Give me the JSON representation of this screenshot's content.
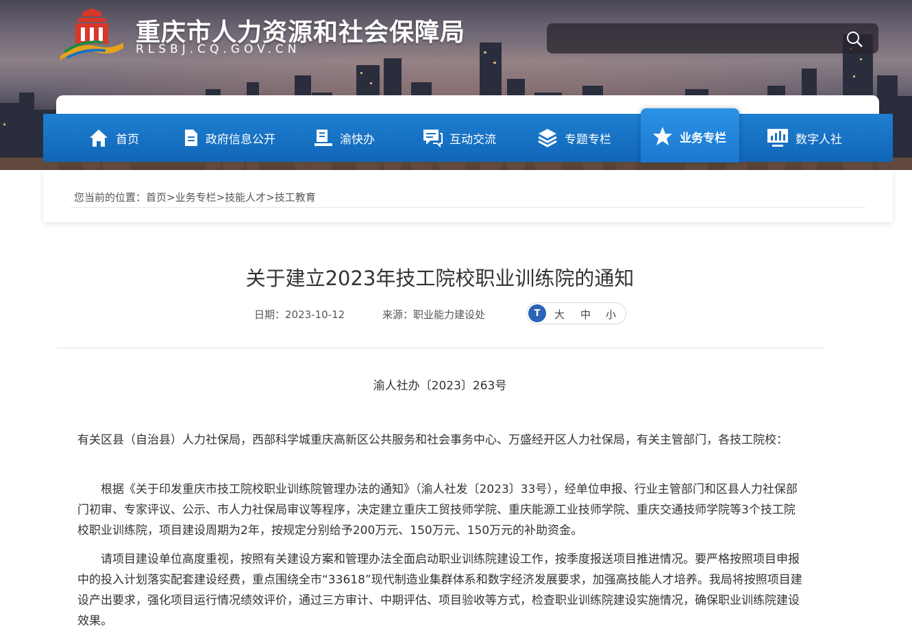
{
  "header": {
    "site_title": "重庆市人力资源和社会保障局",
    "site_domain": "RLSBJ.CQ.GOV.CN",
    "search_icon": "search-icon"
  },
  "nav": {
    "items": [
      {
        "label": "首页",
        "icon": "home-icon"
      },
      {
        "label": "政府信息公开",
        "icon": "document-icon"
      },
      {
        "label": "渝快办",
        "icon": "desk-icon"
      },
      {
        "label": "互动交流",
        "icon": "chat-icon"
      },
      {
        "label": "专题专栏",
        "icon": "layers-icon"
      },
      {
        "label": "业务专栏",
        "icon": "star-icon"
      },
      {
        "label": "数字人社",
        "icon": "monitor-chart-icon"
      }
    ],
    "active": "业务专栏"
  },
  "breadcrumb": "您当前的位置：首页>业务专栏>技能人才>技工教育",
  "article": {
    "title": "关于建立2023年技工院校职业训练院的通知",
    "date": "日期：2023-10-12",
    "source": "来源：职业能力建设处",
    "font_size": {
      "icon_text": "T",
      "large": "大",
      "medium": "中",
      "small": "小"
    },
    "doc_number": "渝人社办〔2023〕263号",
    "paragraphs": [
      "有关区县（自治县）人力社保局，西部科学城重庆高新区公共服务和社会事务中心、万盛经开区人力社保局，有关主管部门，各技工院校：",
      "根据《关于印发重庆市技工院校职业训练院管理办法的通知》（渝人社发〔2023〕33号），经单位申报、行业主管部门和区县人力社保部门初审、专家评议、公示、市人力社保局审议等程序，决定建立重庆工贸技师学院、重庆能源工业技师学院、重庆交通技师学院等3个技工院校职业训练院，项目建设周期为2年，按规定分别给予200万元、150万元、150万元的补助资金。",
      "请项目建设单位高度重视，按照有关建设方案和管理办法全面启动职业训练院建设工作，按季度报送项目推进情况。要严格按照项目申报中的投入计划落实配套建设经费，重点围绕全市“33618”现代制造业集群体系和数字经济发展要求，加强高技能人才培养。我局将按照项目建设产出要求，强化项目运行情况绩效评价，通过三方审计、中期评估、项目验收等方式，检查职业训练院建设实施情况，确保职业训练院建设效果。"
    ]
  }
}
